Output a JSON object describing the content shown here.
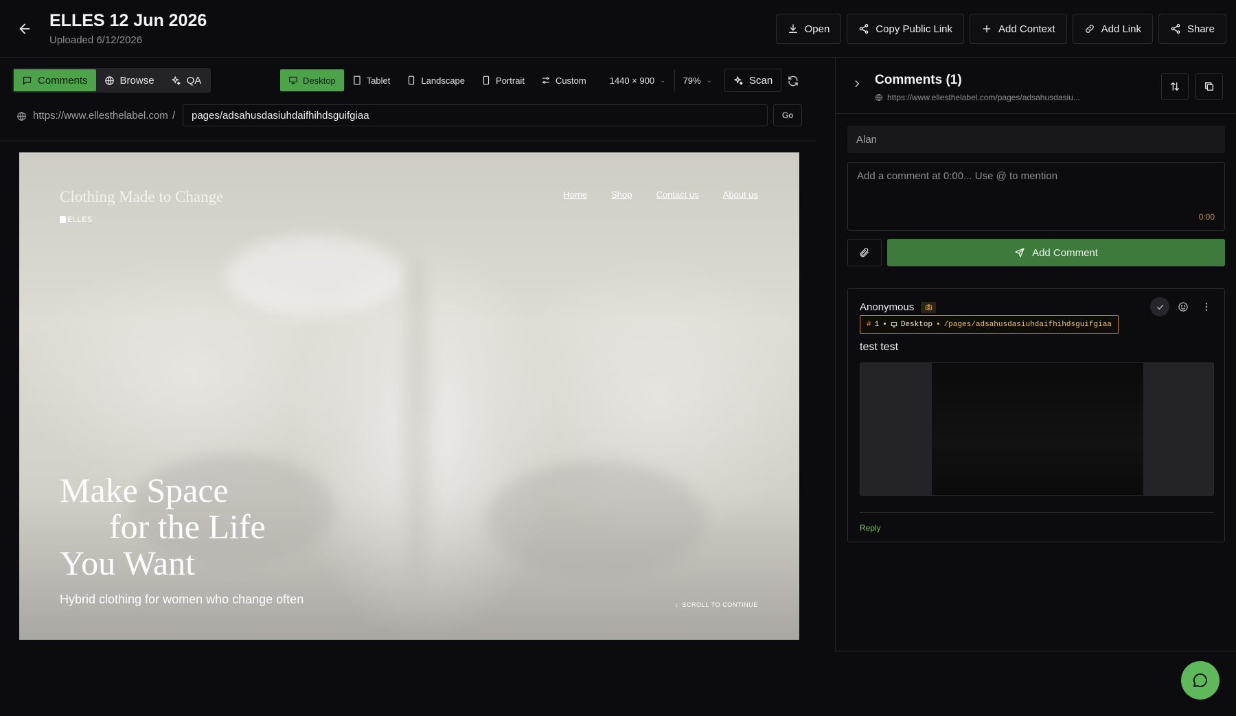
{
  "header": {
    "title": "ELLES 12 Jun 2026",
    "subtitle": "Uploaded 6/12/2026",
    "actions": {
      "open": "Open",
      "copy_public_link": "Copy Public Link",
      "add_context": "Add Context",
      "add_link": "Add Link",
      "share": "Share"
    }
  },
  "toolbar": {
    "modes": {
      "comments": "Comments",
      "browse": "Browse",
      "qa": "QA",
      "active": "Comments"
    },
    "devices": {
      "desktop": "Desktop",
      "tablet": "Tablet",
      "landscape": "Landscape",
      "portrait": "Portrait",
      "custom": "Custom",
      "active": "Desktop"
    },
    "resolution": "1440 × 900",
    "zoom": "79%",
    "scan": "Scan"
  },
  "url_bar": {
    "base": "https://www.ellesthelabel.com",
    "separator": "/",
    "path": "pages/adsahusdasiuhdaifhihdsguifgiaa",
    "go": "Go"
  },
  "preview": {
    "brand": "Clothing Made to Change",
    "logo": "ELLES",
    "nav": [
      "Home",
      "Shop",
      "Contact us",
      "About us"
    ],
    "hero": [
      "Make Space",
      "for the Life",
      "You Want"
    ],
    "subheading": "Hybrid clothing for women who change often",
    "scroll_cue": "SCROLL TO CONTINUE"
  },
  "comments_panel": {
    "title": "Comments (1)",
    "url": "https://www.ellesthelabel.com/pages/adsahusdasiu...",
    "name_value": "Alan",
    "comment_placeholder": "Add a comment at 0:00... Use @ to mention",
    "timecode": "0:00",
    "add_comment": "Add Comment",
    "comments": [
      {
        "author": "Anonymous",
        "number": "1",
        "device": "Desktop",
        "path": "/pages/adsahusdasiuhdaifhihdsguifgiaa",
        "text": "test test",
        "reply": "Reply"
      }
    ]
  },
  "colors": {
    "accent": "#4ca34a",
    "button_green": "#3e7a3c",
    "background": "#0c0c0f",
    "tag_border": "#b8862e"
  },
  "icons": [
    "back-arrow-icon",
    "download-icon",
    "share-nodes-icon",
    "plus-icon",
    "link-icon",
    "comment-icon",
    "globe-icon",
    "sparkles-icon",
    "monitor-icon",
    "tablet-icon",
    "phone-icon",
    "sliders-icon",
    "refresh-icon",
    "chevron-right-icon",
    "sort-icon",
    "copy-icon",
    "paperclip-icon",
    "send-icon",
    "camera-icon",
    "check-icon",
    "smiley-icon",
    "more-vertical-icon",
    "chat-bubble-icon"
  ]
}
